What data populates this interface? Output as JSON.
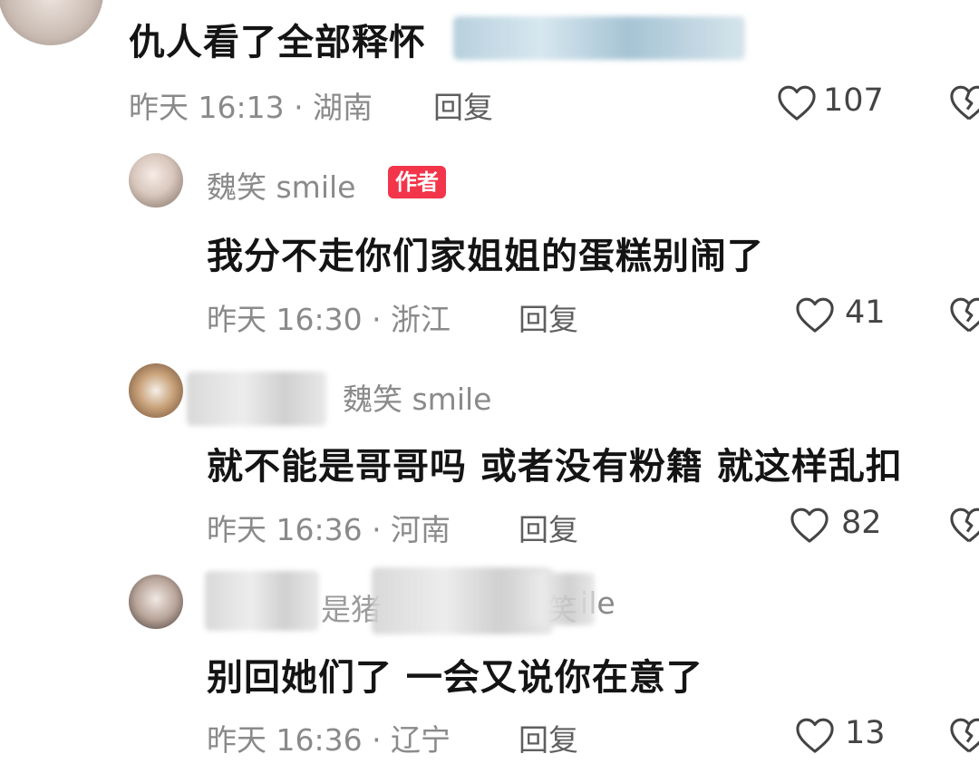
{
  "comments": [
    {
      "text": "仇人看了全部释怀",
      "meta": "昨天 16:13 · 湖南",
      "reply_label": "回复",
      "likes": "107"
    },
    {
      "username": "魏笑 smile",
      "badge": "作者",
      "text": "我分不走你们家姐姐的蛋糕别闹了",
      "meta": "昨天 16:30 · 浙江",
      "reply_label": "回复",
      "likes": "41"
    },
    {
      "reply_to": "魏笑 smile",
      "text": "就不能是哥哥吗 或者没有粉籍 就这样乱扣",
      "meta": "昨天 16:36 · 河南",
      "reply_label": "回复",
      "likes": "82"
    },
    {
      "username_partial_1": "是猪",
      "username_partial_2": "笑",
      "username_partial_3": "ile",
      "text": "别回她们了 一会又说你在意了",
      "meta": "昨天 16:36 · 辽宁",
      "reply_label": "回复",
      "likes": "13"
    }
  ],
  "icons": {
    "like": "heart-outline-icon",
    "dislike": "broken-heart-icon"
  },
  "colors": {
    "badge": "#f2354a",
    "meta": "#8a8a8a",
    "text": "#141414"
  }
}
